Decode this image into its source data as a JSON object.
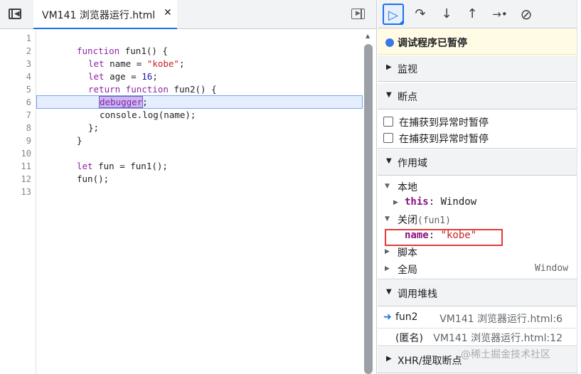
{
  "editor": {
    "file_tab": {
      "label": "VM141 浏览器运行.html",
      "close": "✕"
    },
    "line_numbers": [
      "1",
      "2",
      "3",
      "4",
      "5",
      "6",
      "7",
      "8",
      "9",
      "10",
      "11",
      "12",
      "13"
    ],
    "code": {
      "l2": {
        "kw": "function",
        "rest": " fun1() {"
      },
      "l3": {
        "kw": "let",
        "mid": " name = ",
        "str": "\"kobe\"",
        "end": ";"
      },
      "l4": {
        "kw": "let",
        "mid": " age = ",
        "num": "16",
        "end": ";"
      },
      "l5": {
        "kw": "return",
        "kw2": " function",
        "rest": " fun2() {"
      },
      "l6": {
        "kw": "debugger",
        "end": ";"
      },
      "l7": {
        "text": "console.log(name);"
      },
      "l8": {
        "text": "};"
      },
      "l9": {
        "text": "}"
      },
      "l11": {
        "kw": "let",
        "rest": " fun = fun1();"
      },
      "l12": {
        "text": "fun();"
      }
    }
  },
  "debugger": {
    "toolbar": {
      "resume": "▷",
      "step_over": "↷",
      "step_into": "↓",
      "step_out": "↑",
      "step": "→•",
      "deactivate": "⊘"
    },
    "paused_banner": "调试程序已暂停",
    "sections": {
      "watch": "监视",
      "breakpoints": "断点",
      "scope": "作用域",
      "call_stack": "调用堆栈",
      "xhr": "XHR/提取断点"
    },
    "breakpoints": {
      "pause_caught": "在捕获到异常时暂停",
      "pause_uncaught": "在捕获到异常时暂停"
    },
    "scope": {
      "local": "本地",
      "this_name": "this",
      "this_sep": ": ",
      "this_value": "Window",
      "closure": "关闭",
      "closure_fn": "(fun1)",
      "var_name": "name",
      "var_sep": ": ",
      "var_value": "\"kobe\"",
      "script": "脚本",
      "global": "全局",
      "global_value": "Window"
    },
    "call_stack": [
      {
        "fn": "fun2",
        "loc": "VM141 浏览器运行.html:6"
      },
      {
        "fn": "(匿名)",
        "loc": "VM141 浏览器运行.html:12"
      }
    ]
  },
  "watermark": "@稀土掘金技术社区",
  "colors": {
    "accent": "#1a73e8",
    "highlight_box": "#e53935",
    "paused_bg": "#fffbe5"
  }
}
